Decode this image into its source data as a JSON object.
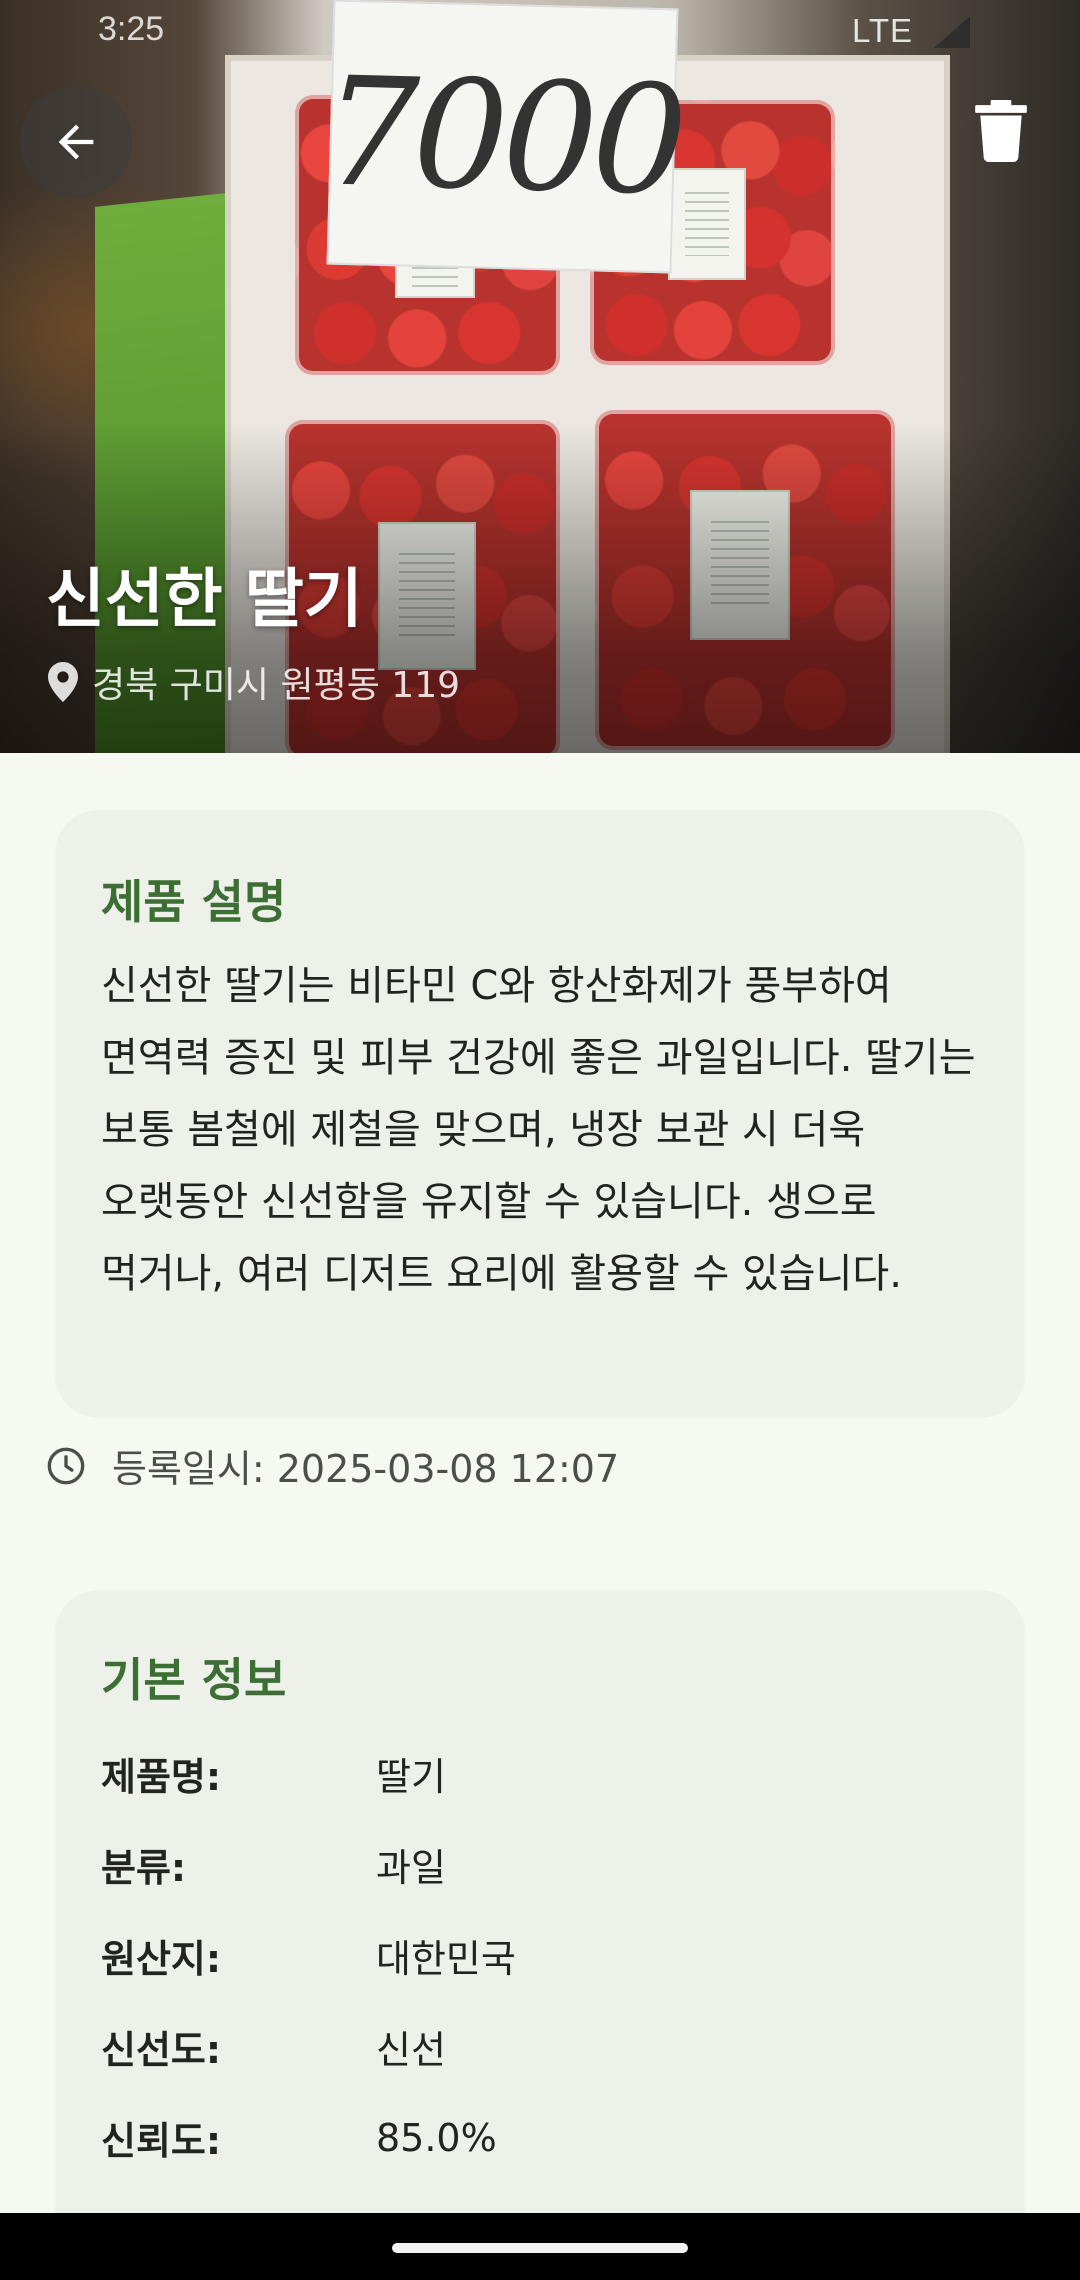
{
  "status_bar": {
    "time": "3:25",
    "network": "LTE"
  },
  "hero": {
    "price_sign": "7000",
    "title": "신선한 딸기",
    "location": "경북 구미시 원평동 119",
    "back_icon": "arrow-left-icon",
    "delete_icon": "trash-icon"
  },
  "description": {
    "title": "제품 설명",
    "body": "신선한 딸기는 비타민 C와 항산화제가 풍부하여 면역력 증진 및 피부 건강에 좋은 과일입니다. 딸기는 보통 봄철에 제철을 맞으며, 냉장 보관 시 더욱 오랫동안 신선함을 유지할 수 있습니다. 생으로 먹거나, 여러 디저트 요리에 활용할 수 있습니다."
  },
  "registration": {
    "text": "등록일시: 2025-03-08 12:07"
  },
  "basic_info": {
    "title": "기본 정보",
    "rows": [
      {
        "label": "제품명:",
        "value": "딸기"
      },
      {
        "label": "분류:",
        "value": "과일"
      },
      {
        "label": "원산지:",
        "value": "대한민국"
      },
      {
        "label": "신선도:",
        "value": "신선"
      },
      {
        "label": "신뢰도:",
        "value": "85.0%"
      }
    ]
  },
  "colors": {
    "accent": "#3d6e34",
    "card": "#eef1ea",
    "background": "#f6f9f1"
  }
}
